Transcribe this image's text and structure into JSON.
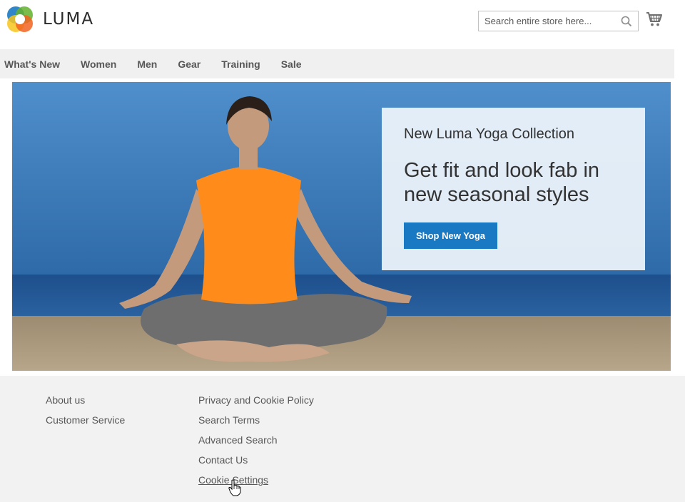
{
  "brand": {
    "name": "LUMA",
    "colors": {
      "blue": "#1979c3",
      "orange": "#f26322",
      "green": "#64b22e",
      "yellow": "#f8c51c"
    }
  },
  "header": {
    "search_placeholder": "Search entire store here...",
    "search_icon": "search-icon",
    "cart_icon": "cart-icon"
  },
  "nav": {
    "items": [
      {
        "label": "What's New"
      },
      {
        "label": "Women"
      },
      {
        "label": "Men"
      },
      {
        "label": "Gear"
      },
      {
        "label": "Training"
      },
      {
        "label": "Sale"
      }
    ]
  },
  "hero": {
    "subtitle": "New Luma Yoga Collection",
    "title_line1": "Get fit and look fab in",
    "title_line2": "new seasonal styles",
    "button_label": "Shop New Yoga",
    "button_color": "#1979c3"
  },
  "footer": {
    "col1": [
      {
        "label": "About us"
      },
      {
        "label": "Customer Service"
      }
    ],
    "col2": [
      {
        "label": "Privacy and Cookie Policy"
      },
      {
        "label": "Search Terms"
      },
      {
        "label": "Advanced Search"
      },
      {
        "label": "Contact Us"
      },
      {
        "label": "Cookie Settings"
      }
    ]
  }
}
